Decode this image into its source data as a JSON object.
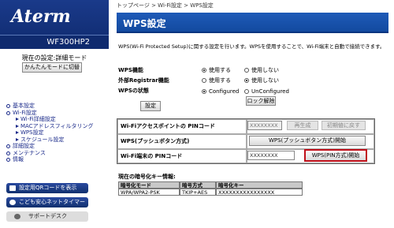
{
  "sidebar": {
    "logo": "Aterm",
    "model": "WF300HP2",
    "mode_label": "現在の設定:詳細モード",
    "mode_button": "かんたんモードに切替",
    "nav": [
      {
        "label": "基本設定",
        "level": 0
      },
      {
        "label": "Wi-Fi設定",
        "level": 0
      },
      {
        "label": "Wi-Fi詳細設定",
        "level": 1
      },
      {
        "label": "MACアドレスフィルタリング",
        "level": 1
      },
      {
        "label": "WPS設定",
        "level": 1
      },
      {
        "label": "スケジュール設定",
        "level": 1
      },
      {
        "label": "詳細設定",
        "level": 0
      },
      {
        "label": "メンテナンス",
        "level": 0
      },
      {
        "label": "情報",
        "level": 0
      }
    ],
    "qr_button": "設定用QRコードを表示",
    "kids_button": "こども安心ネットタイマー",
    "support_button": "サポートデスク"
  },
  "main": {
    "breadcrumb": "トップページ > Wi-Fi設定 > WPS設定",
    "title": "WPS設定",
    "description": "WPS(Wi-Fi Protected Setup)に関する設定を行います。WPSを使用することで、Wi-Fi端末と自動で接続できます。",
    "wps_func": {
      "label": "WPS機能",
      "opt1": "使用する",
      "opt2": "使用しない",
      "selected": 1
    },
    "registrar": {
      "label": "外部Registrar機能",
      "opt1": "使用する",
      "opt2": "使用しない",
      "selected": 2
    },
    "wps_state": {
      "label": "WPSの状態",
      "opt1": "Configured",
      "opt2": "UnConfigured",
      "selected": 1
    },
    "lock_button": "ロック解除",
    "set_button": "設定",
    "pin_row_label": "Wi-Fiアクセスポイントの PINコード",
    "pin_value": "XXXXXXXX",
    "regen_button": "再生成",
    "reset_button": "初期値に戻す",
    "push_row_label": "WPS(プッシュボタン方式)",
    "push_button": "WPS(プッシュボタン方式)開始",
    "client_pin_label": "Wi-Fi端末の PINコード",
    "client_pin_value": "XXXXXXXX",
    "pin_start_button": "WPS(PIN方式)開始",
    "key_title": "現在の暗号化キー情報:",
    "key_headers": [
      "暗号化モード",
      "暗号方式",
      "暗号化キー"
    ],
    "key_row": [
      "WPA/WPA2-PSK",
      "TKIP+AES",
      "XXXXXXXXXXXXXXXX"
    ]
  },
  "colors": {
    "title_bar": "#1e5ab8",
    "nav_text": "#1a2a8a",
    "highlight": "#c0101a"
  }
}
